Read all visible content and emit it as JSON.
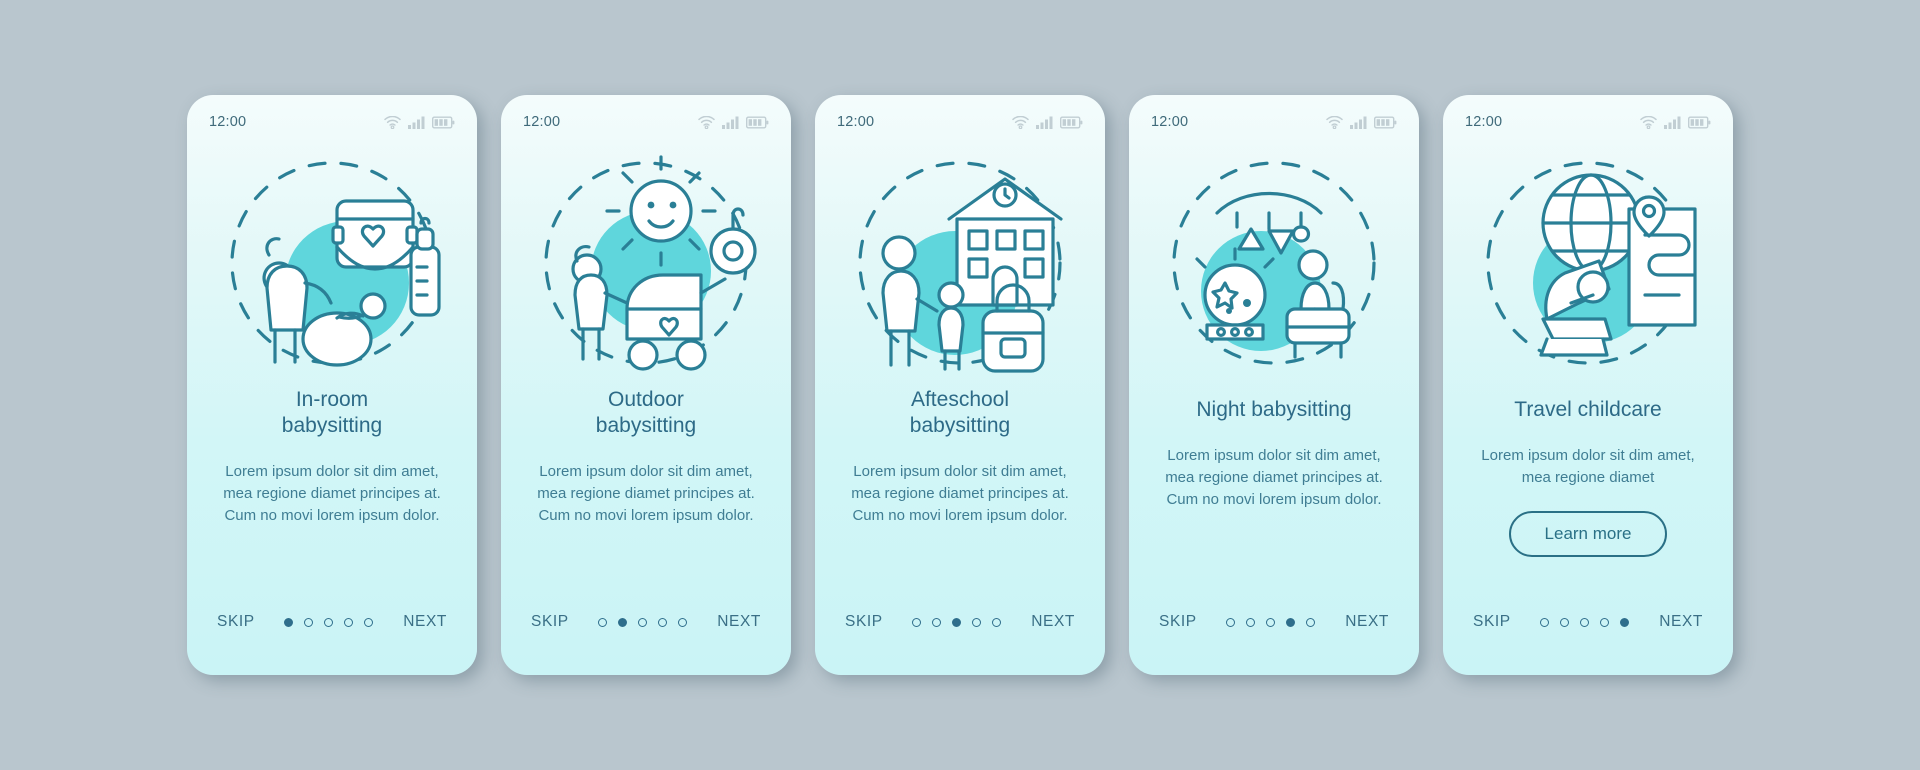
{
  "theme": {
    "page_background": "#b9c6ce",
    "accent": "#5fd6dc",
    "ink": "#2d6a87",
    "body_ink": "#3f7d93",
    "dot_active": "#2f6e8c"
  },
  "status_bar": {
    "time": "12:00",
    "icons": [
      "wifi-icon",
      "cellular-signal-icon",
      "battery-icon"
    ]
  },
  "nav": {
    "skip_label": "SKIP",
    "next_label": "NEXT",
    "total_dots": 5
  },
  "screens": [
    {
      "id": "in-room-babysitting",
      "illustration": "nanny-changing-baby-diaper-bottle-icon",
      "title": "In-room\nbabysitting",
      "title_lines": [
        "In-room",
        "babysitting"
      ],
      "description": "Lorem ipsum dolor sit dim amet, mea regione diamet principes at. Cum no movi lorem ipsum dolor.",
      "active_dot": 1,
      "cta": null
    },
    {
      "id": "outdoor-babysitting",
      "illustration": "nanny-stroller-sun-pacifier-icon",
      "title": "Outdoor\nbabysitting",
      "title_lines": [
        "Outdoor",
        "babysitting"
      ],
      "description": "Lorem ipsum dolor sit dim amet, mea regione diamet principes at. Cum no movi lorem ipsum dolor.",
      "active_dot": 2,
      "cta": null
    },
    {
      "id": "afteschool-babysitting",
      "illustration": "nanny-child-school-backpack-icon",
      "title": "Afteschool\nbabysitting",
      "title_lines": [
        "Afteschool",
        "babysitting"
      ],
      "description": "Lorem ipsum dolor sit dim amet, mea regione diamet principes at. Cum no movi lorem ipsum dolor.",
      "active_dot": 3,
      "cta": null
    },
    {
      "id": "night-babysitting",
      "illustration": "night-lamp-mobile-stars-nanny-armchair-icon",
      "title": "Night babysitting",
      "title_lines": [
        "Night babysitting"
      ],
      "description": "Lorem ipsum dolor sit dim amet, mea regione diamet principes at. Cum no movi lorem ipsum dolor.",
      "active_dot": 4,
      "cta": null
    },
    {
      "id": "travel-childcare",
      "illustration": "globe-car-seat-map-location-icon",
      "title": "Travel childcare",
      "title_lines": [
        "Travel childcare"
      ],
      "description": "Lorem ipsum dolor sit dim amet, mea regione diamet",
      "active_dot": 5,
      "cta": "Learn more"
    }
  ]
}
